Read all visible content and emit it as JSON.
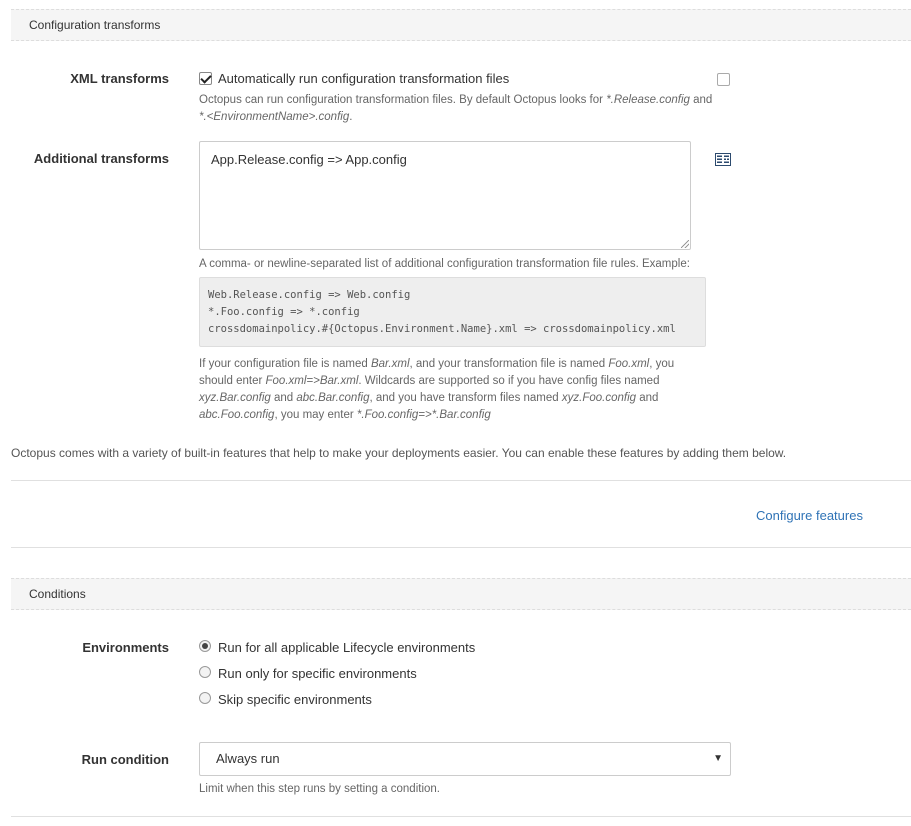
{
  "config_section": {
    "title": "Configuration transforms",
    "xml_transforms": {
      "label": "XML transforms",
      "checkbox_label": "Automatically run configuration transformation files",
      "checked": true,
      "help_1": "Octopus can run configuration transformation files. By default Octopus looks for ",
      "help_2": "*.Release.config",
      "help_3": " and",
      "help_4": "*.<EnvironmentName>.config",
      "help_5": "."
    },
    "additional_transforms": {
      "label": "Additional transforms",
      "value": "App.Release.config => App.config",
      "help": "A comma- or newline-separated list of additional configuration transformation file rules. Example:",
      "example_lines": [
        "Web.Release.config => Web.config",
        "*.Foo.config => *.config",
        "crossdomainpolicy.#{Octopus.Environment.Name}.xml => crossdomainpolicy.xml"
      ],
      "detail": {
        "l1a": "If your configuration file is named ",
        "l1b": "Bar.xml",
        "l1c": ", and your transformation file is named ",
        "l1d": "Foo.xml",
        "l1e": ", you",
        "l2a": "should enter ",
        "l2b": "Foo.xml=>Bar.xml",
        "l2c": ". Wildcards are supported so if you have config files named",
        "l3a": "xyz.Bar.config",
        "l3b": " and ",
        "l3c": "abc.Bar.config",
        "l3d": ", and you have transform files named ",
        "l3e": "xyz.Foo.config",
        "l3f": " and",
        "l4a": "abc.Foo.config",
        "l4b": ", you may enter ",
        "l4c": "*.Foo.config=>*.Bar.config"
      }
    }
  },
  "features_note": "Octopus comes with a variety of built-in features that help to make your deployments easier. You can enable these features by adding them below.",
  "configure_features_link": "Configure features",
  "conditions_section": {
    "title": "Conditions",
    "environments": {
      "label": "Environments",
      "options": [
        "Run for all applicable Lifecycle environments",
        "Run only for specific environments",
        "Skip specific environments"
      ],
      "selected_index": 0
    },
    "run_condition": {
      "label": "Run condition",
      "selected": "Always run",
      "help": "Limit when this step runs by setting a condition."
    }
  },
  "colors": {
    "link": "#2f73b6",
    "header_bg": "#f5f5f5"
  }
}
